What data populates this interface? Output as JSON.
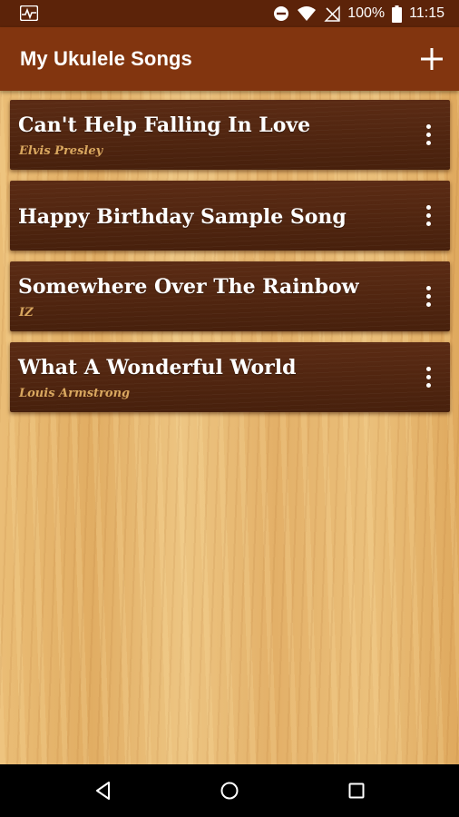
{
  "status_bar": {
    "battery_percent": "100%",
    "time": "11:15",
    "icons": [
      "activity-icon",
      "do-not-disturb-icon",
      "wifi-icon",
      "no-signal-icon",
      "battery-icon"
    ]
  },
  "app_bar": {
    "title": "My Ukulele Songs",
    "add_icon": "plus-icon"
  },
  "songs": [
    {
      "title": "Can't Help Falling In Love",
      "artist": "Elvis Presley"
    },
    {
      "title": "Happy Birthday Sample Song",
      "artist": ""
    },
    {
      "title": "Somewhere Over The Rainbow",
      "artist": "IZ"
    },
    {
      "title": "What A Wonderful World",
      "artist": "Louis Armstrong"
    }
  ],
  "nav_bar": {
    "icons": [
      "back-icon",
      "home-icon",
      "recents-icon"
    ]
  },
  "colors": {
    "status_bar": "#5c2309",
    "app_bar": "#82350f",
    "card": "#4f2410",
    "artist_text": "#d9a75f",
    "wood": "#e4b169"
  }
}
